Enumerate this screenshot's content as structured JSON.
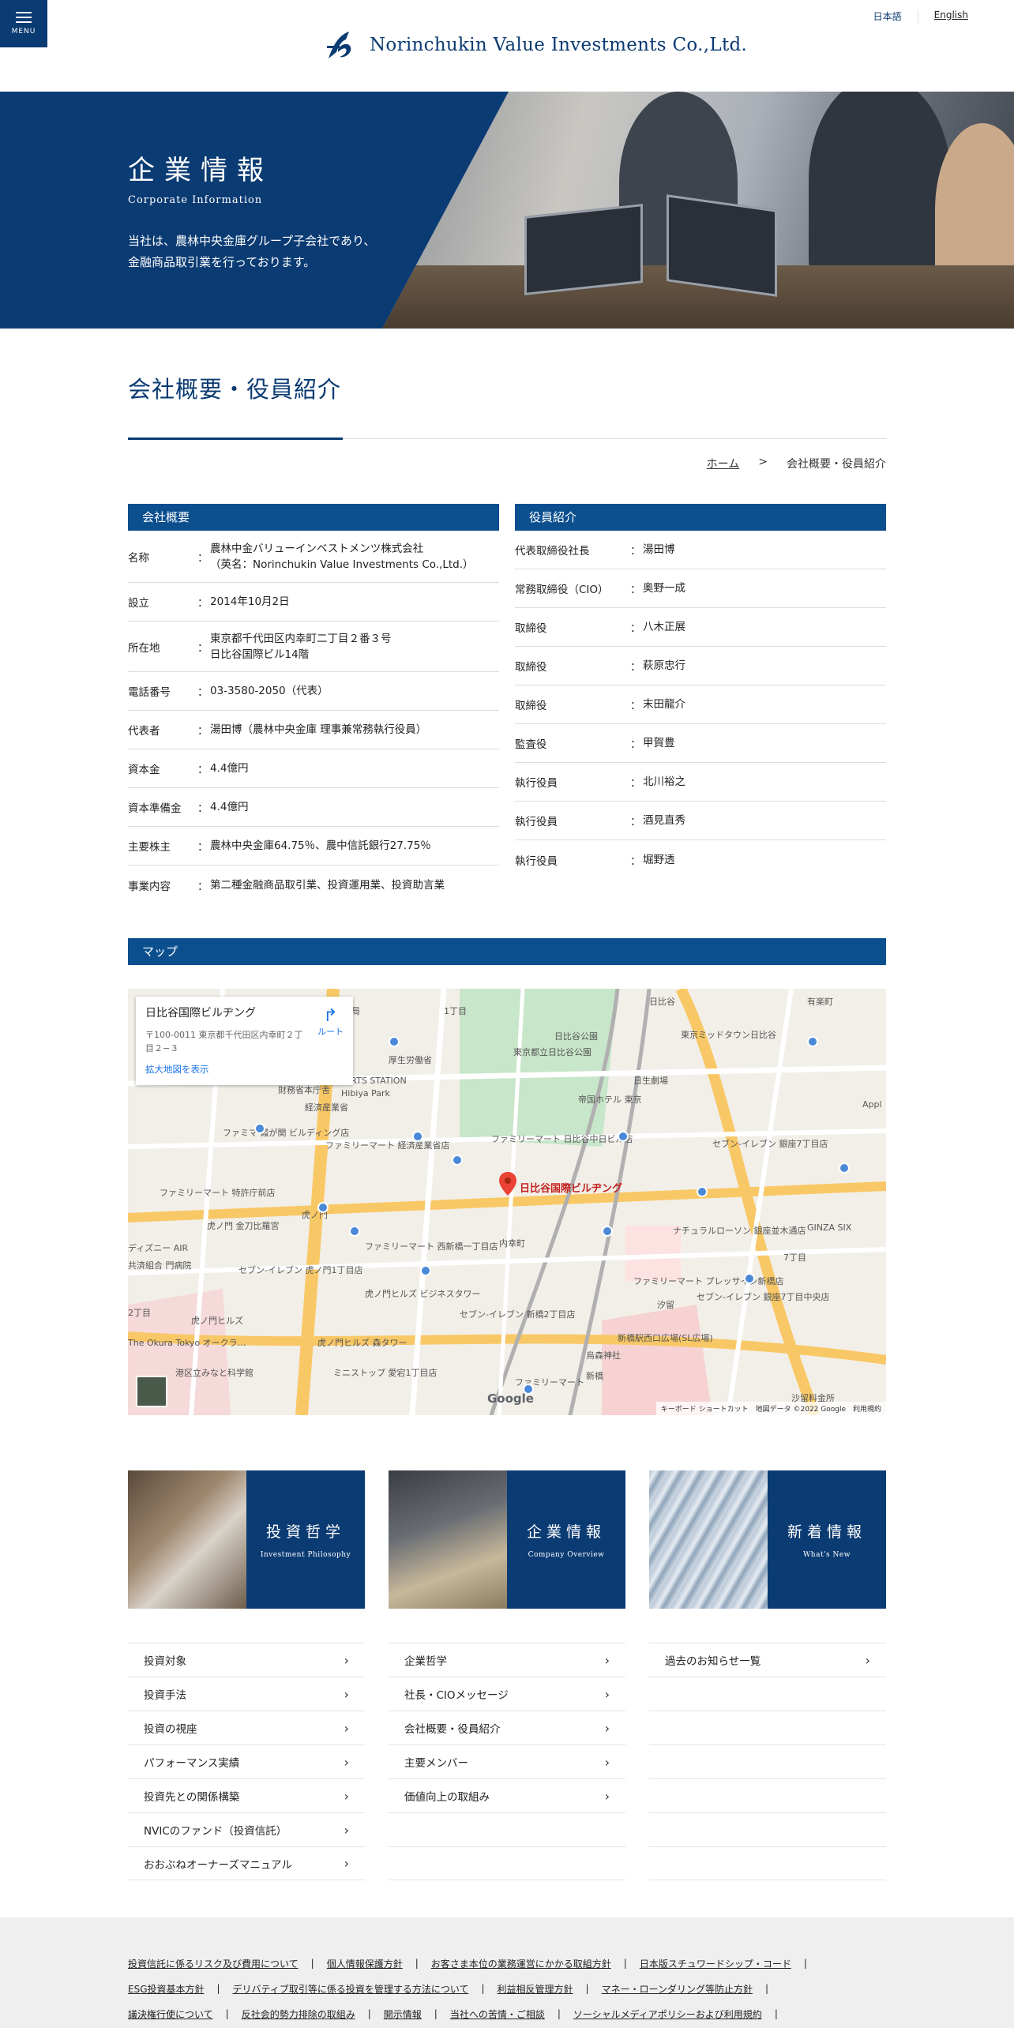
{
  "header": {
    "menu_label": "MENU",
    "company_name": "Norinchukin Value Investments Co.,Ltd.",
    "lang_ja": "日本語",
    "lang_en": "English",
    "brand_color": "#0b3b73"
  },
  "hero": {
    "title": "企業情報",
    "subtitle": "Corporate Information",
    "desc_line1": "当社は、農林中央金庫グループ子会社であり、",
    "desc_line2": "金融商品取引業を行っております。"
  },
  "page_title": "会社概要・役員紹介",
  "breadcrumb": {
    "home": "ホーム",
    "sep": ">",
    "current": "会社概要・役員紹介"
  },
  "company": {
    "heading": "会社概要",
    "rows": [
      {
        "k": "名称",
        "v": "農林中金バリューインベストメンツ株式会社\n（英名：Norinchukin Value Investments Co.,Ltd.）"
      },
      {
        "k": "設立",
        "v": "2014年10月2日"
      },
      {
        "k": "所在地",
        "v": "東京都千代田区内幸町二丁目２番３号\n日比谷国際ビル14階"
      },
      {
        "k": "電話番号",
        "v": "03-3580-2050（代表）"
      },
      {
        "k": "代表者",
        "v": "湯田博（農林中央金庫 理事兼常務執行役員）"
      },
      {
        "k": "資本金",
        "v": "4.4億円"
      },
      {
        "k": "資本準備金",
        "v": "4.4億円"
      },
      {
        "k": "主要株主",
        "v": "農林中央金庫64.75％、農中信託銀行27.75％"
      },
      {
        "k": "事業内容",
        "v": "第二種金融商品取引業、投資運用業、投資助言業"
      }
    ]
  },
  "executives": {
    "heading": "役員紹介",
    "rows": [
      {
        "k": "代表取締役社長",
        "v": "湯田博"
      },
      {
        "k": "常務取締役（CIO）",
        "v": "奥野一成"
      },
      {
        "k": "取締役",
        "v": "八木正展"
      },
      {
        "k": "取締役",
        "v": "萩原忠行"
      },
      {
        "k": "取締役",
        "v": "末田龍介"
      },
      {
        "k": "監査役",
        "v": "甲賀豊"
      },
      {
        "k": "執行役員",
        "v": "北川裕之"
      },
      {
        "k": "執行役員",
        "v": "酒見直秀"
      },
      {
        "k": "執行役員",
        "v": "堀野透"
      }
    ]
  },
  "sep_char": "：",
  "map": {
    "heading": "マップ",
    "place_name": "日比谷国際ビルヂング",
    "address": "〒100-0011 東京都千代田区内幸町２丁目２−３",
    "enlarge": "拡大地図を表示",
    "route": "ルート",
    "pin_label": "日比谷国際ビルヂング",
    "google": "Google",
    "attribution": "キーボード ショートカット　地図データ ©2022 Google　利用規約",
    "labels": [
      "関郵便局",
      "1丁目",
      "日比谷",
      "有楽町",
      "東京ミッドタウン日比谷",
      "日比谷公園",
      "東京都立日比谷公園",
      "日生劇場",
      "厚生労働省",
      "財務省本庁舎",
      "経済産業省",
      "SPORTS STATION",
      "Hibiya Park",
      "帝国ホテル 東京",
      "ファミマ 霞が関 ビルディング店",
      "ファミリーマート 経済産業省店",
      "ファミリーマート 日比谷中日ビル店",
      "セブン-イレブン 銀座7丁目店",
      "ファミリーマート 特許庁前店",
      "虎ノ門 金刀比羅宮",
      "虎ノ門",
      "内幸町",
      "ナチュラルローソン 銀座並木通店",
      "GINZA SIX",
      "7丁目",
      "ファミリーマート 西新橋一丁目店",
      "セブン-イレブン 虎ノ門1丁目店",
      "虎ノ門ヒルズ ビジネスタワー",
      "ファミリーマート プレッサイン新橋店",
      "セブン-イレブン 銀座7丁目中央店",
      "虎ノ門ヒルズ",
      "2丁目",
      "セブン-イレブン 新橋2丁目店",
      "新橋駅西口広場(SL広場)",
      "虎ノ門ヒルズ 森タワー",
      "烏森神社",
      "The Okura Tokyo オークラ…",
      "港区立みなと科学館",
      "ミニストップ 愛宕1丁目店",
      "ファミリーマート",
      "新橋",
      "汐留",
      "ディズニー AIR",
      "共済組合 門病院",
      "Appl",
      "沙留料金所"
    ]
  },
  "cards": [
    {
      "jp": "投資哲学",
      "en": "Investment Philosophy"
    },
    {
      "jp": "企業情報",
      "en": "Company Overview"
    },
    {
      "jp": "新着情報",
      "en": "What's New"
    }
  ],
  "links": {
    "col1": [
      "投資対象",
      "投資手法",
      "投資の視座",
      "パフォーマンス実績",
      "投資先との関係構築",
      "NVICのファンド（投資信託）",
      "おおぶねオーナーズマニュアル"
    ],
    "col2": [
      "企業哲学",
      "社長・CIOメッセージ",
      "会社概要・役員紹介",
      "主要メンバー",
      "価値向上の取組み"
    ],
    "col3": [
      "過去のお知らせ一覧"
    ]
  },
  "footer": {
    "line1": [
      "投資信託に係るリスク及び費用について",
      "個人情報保護方針",
      "お客さま本位の業務運営にかかる取組方針",
      "日本版スチュワードシップ・コード"
    ],
    "line2": [
      "ESG投資基本方針",
      "デリバティブ取引等に係る投資を管理する方法について",
      "利益相反管理方針",
      "マネー・ローンダリング等防止方針"
    ],
    "line3": [
      "議決権行使について",
      "反社会的勢力排除の取組み",
      "開示情報",
      "当社への苦情・ご相談",
      "ソーシャルメディアポリシーおよび利用規約"
    ]
  }
}
